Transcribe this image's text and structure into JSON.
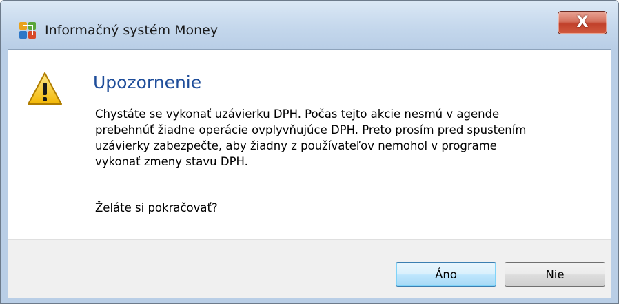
{
  "window": {
    "title": "Informačný systém Money",
    "close_label": "X",
    "icon": "money-app-icon"
  },
  "dialog": {
    "icon": "warning-icon",
    "heading": "Upozornenie",
    "message_lines": [
      "Chystáte se vykonať uzávierku DPH. Počas tejto akcie nesmú v agende",
      "prebehnúť žiadne operácie ovplyvňujúce DPH. Preto prosím pred spustením",
      "uzávierky zabezpečte, aby žiadny z používateľov nemohol v programe",
      "vykonať zmeny stavu DPH."
    ],
    "question": "Želáte si pokračovať?"
  },
  "buttons": {
    "yes_label": "Áno",
    "no_label": "Nie"
  },
  "colors": {
    "heading": "#1e4d9a",
    "close_button": "#c1412b",
    "default_button_border": "#3c7fb1"
  }
}
